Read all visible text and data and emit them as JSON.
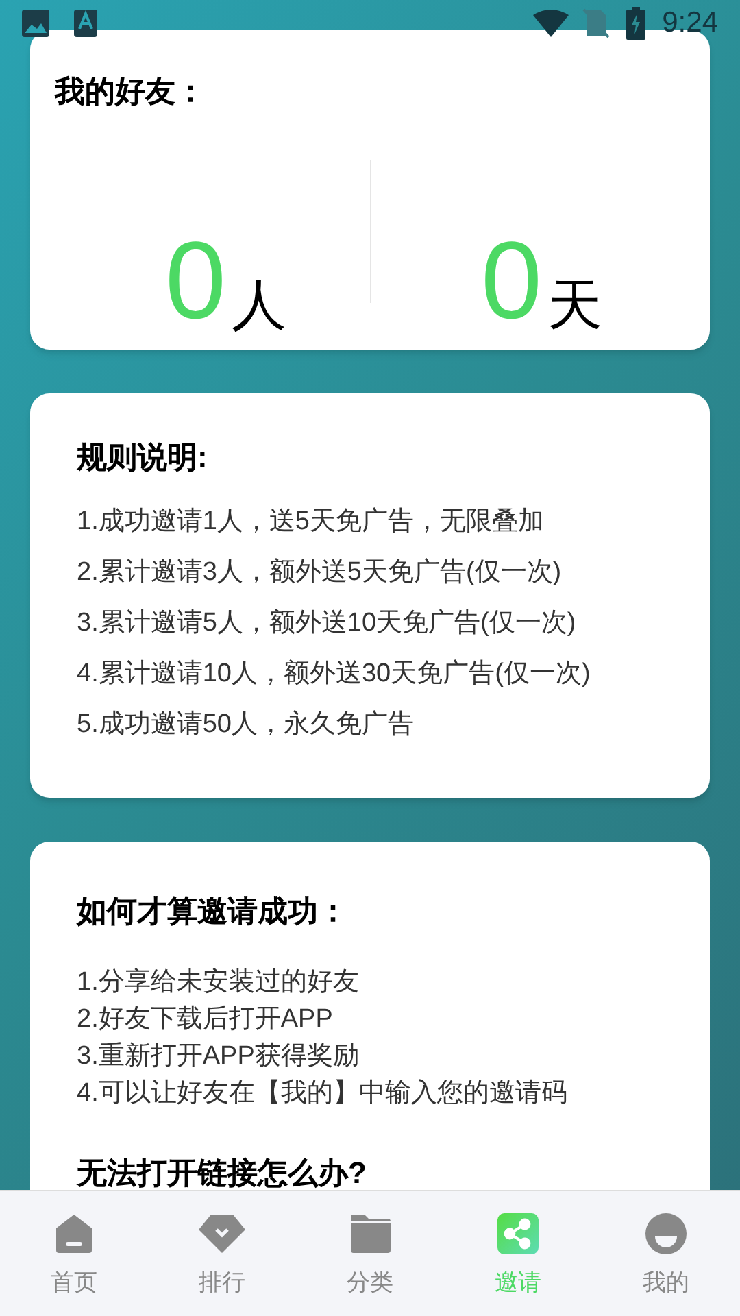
{
  "status_bar": {
    "time": "9:24"
  },
  "friends_card": {
    "title": "我的好友：",
    "stats": [
      {
        "value": "0",
        "unit": "人"
      },
      {
        "value": "0",
        "unit": "天"
      }
    ]
  },
  "rules_card": {
    "title": "规则说明:",
    "items": [
      "1.成功邀请1人，送5天免广告，无限叠加",
      "2.累计邀请3人，额外送5天免广告(仅一次)",
      "3.累计邀请5人，额外送10天免广告(仅一次)",
      "4.累计邀请10人，额外送30天免广告(仅一次)",
      "5.成功邀请50人，永久免广告"
    ]
  },
  "success_card": {
    "title": "如何才算邀请成功：",
    "items": [
      "1.分享给未安装过的好友",
      "2.好友下载后打开APP",
      "3.重新打开APP获得奖励",
      "4.可以让好友在【我的】中输入您的邀请码"
    ],
    "next_title": "无法打开链接怎么办?"
  },
  "bottom_nav": [
    {
      "kind": "home",
      "label": "首页",
      "selected": false
    },
    {
      "kind": "rank",
      "label": "排行",
      "selected": false
    },
    {
      "kind": "category",
      "label": "分类",
      "selected": false
    },
    {
      "kind": "invite",
      "label": "邀请",
      "selected": true
    },
    {
      "kind": "mine",
      "label": "我的",
      "selected": false
    }
  ]
}
